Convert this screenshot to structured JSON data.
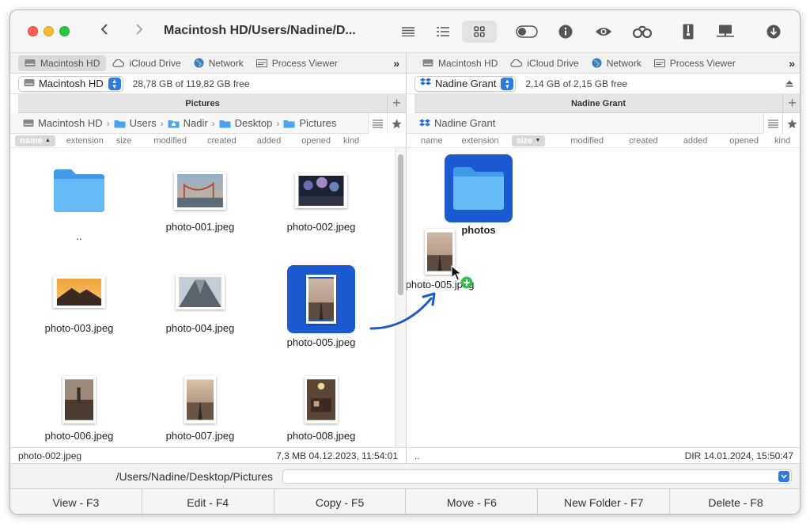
{
  "title": "Macintosh HD/Users/Nadine/D...",
  "left": {
    "tabs": [
      {
        "label": "Macintosh HD",
        "icon": "hard-drive-icon"
      },
      {
        "label": "iCloud Drive",
        "icon": "cloud-icon"
      },
      {
        "label": "Network",
        "icon": "globe-icon"
      },
      {
        "label": "Process Viewer",
        "icon": "process-icon"
      }
    ],
    "drive": {
      "label": "Macintosh HD",
      "free": "28,78 GB of 119,82 GB free"
    },
    "header": "Pictures",
    "breadcrumb": [
      "Macintosh HD",
      "Users",
      "Nadir",
      "Desktop",
      "Pictures"
    ],
    "columns": [
      "name",
      "extension",
      "size",
      "modified",
      "created",
      "added",
      "opened",
      "kind"
    ],
    "files": [
      {
        "name": ".."
      },
      {
        "name": "photo-001.jpeg"
      },
      {
        "name": "photo-002.jpeg"
      },
      {
        "name": "photo-003.jpeg"
      },
      {
        "name": "photo-004.jpeg"
      },
      {
        "name": "photo-005.jpeg"
      },
      {
        "name": "photo-006.jpeg"
      },
      {
        "name": "photo-007.jpeg"
      },
      {
        "name": "photo-008.jpeg"
      }
    ],
    "status": {
      "name": "photo-002.jpeg",
      "info": "7,3 MB   04.12.2023, 11:54:01"
    }
  },
  "right": {
    "tabs": [
      {
        "label": "Macintosh HD",
        "icon": "hard-drive-icon"
      },
      {
        "label": "iCloud Drive",
        "icon": "cloud-icon"
      },
      {
        "label": "Network",
        "icon": "globe-icon"
      },
      {
        "label": "Process Viewer",
        "icon": "process-icon"
      }
    ],
    "drive": {
      "label": "Nadine Grant",
      "free": "2,14 GB of 2,15 GB free"
    },
    "header": "Nadine Grant",
    "breadcrumb": [
      "Nadine Grant"
    ],
    "columns": [
      "name",
      "extension",
      "size",
      "modified",
      "created",
      "added",
      "opened",
      "kind"
    ],
    "files": [
      {
        "name": "photos"
      }
    ],
    "dragged": {
      "name": "photo-005.jpeg"
    },
    "status": {
      "name": "..",
      "info": "DIR   14.01.2024, 15:50:47"
    }
  },
  "command_path": "/Users/Nadine/Desktop/Pictures",
  "fkeys": [
    "View - F3",
    "Edit - F4",
    "Copy - F5",
    "Move - F6",
    "New Folder - F7",
    "Delete - F8"
  ],
  "colors": {
    "selection": "#1b5ad1",
    "accent": "#2c7be5",
    "folder": "#5ab4f5"
  }
}
